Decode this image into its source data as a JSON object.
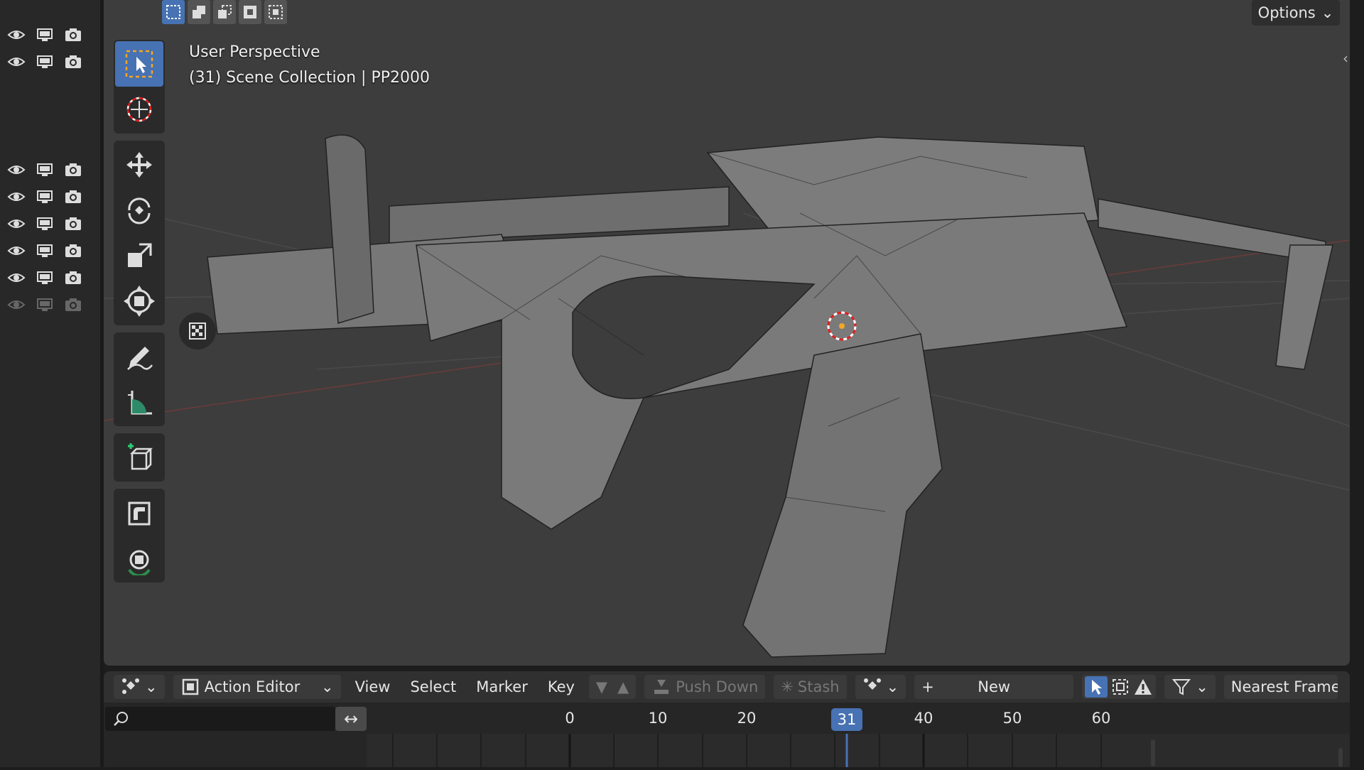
{
  "viewport": {
    "perspective": "User Perspective",
    "collection": "(31) Scene Collection | PP2000",
    "options_label": "Options"
  },
  "outliner": {
    "rows": [
      {
        "icons": [
          "eye-icon",
          "monitor-icon",
          "camera-icon"
        ],
        "enabled": true
      },
      {
        "icons": [
          "eye-icon",
          "monitor-icon",
          "camera-icon"
        ],
        "enabled": true
      },
      {
        "icons": [
          "eye-icon",
          "monitor-icon",
          "camera-icon"
        ],
        "enabled": true
      },
      {
        "icons": [
          "eye-icon",
          "monitor-icon",
          "camera-icon"
        ],
        "enabled": true
      },
      {
        "icons": [
          "eye-icon",
          "monitor-icon",
          "camera-icon"
        ],
        "enabled": true
      },
      {
        "icons": [
          "eye-icon",
          "monitor-icon",
          "camera-icon"
        ],
        "enabled": true
      },
      {
        "icons": [
          "eye-icon",
          "monitor-icon",
          "camera-icon"
        ],
        "enabled": true
      },
      {
        "icons": [
          "eye-icon",
          "monitor-icon",
          "camera-icon"
        ],
        "enabled": false
      }
    ]
  },
  "toolbar": {
    "tools": [
      "select-box",
      "cursor",
      "move",
      "rotate",
      "scale",
      "transform",
      "annotate",
      "measure",
      "add-cube",
      "extrude",
      "spin"
    ],
    "active": "select-box"
  },
  "action_header": {
    "editor_type": "Action Editor",
    "menus": [
      "View",
      "Select",
      "Marker",
      "Key"
    ],
    "push_down": "Push Down",
    "stash": "Stash",
    "new": "New",
    "snap": "Nearest Frame"
  },
  "timeline": {
    "ticks": [
      "0",
      "10",
      "20",
      "40",
      "50",
      "60"
    ],
    "current_frame": "31"
  },
  "colors": {
    "accent": "#4772b3",
    "viewport_bg": "#3d3d3d",
    "panel_bg": "#303030"
  }
}
